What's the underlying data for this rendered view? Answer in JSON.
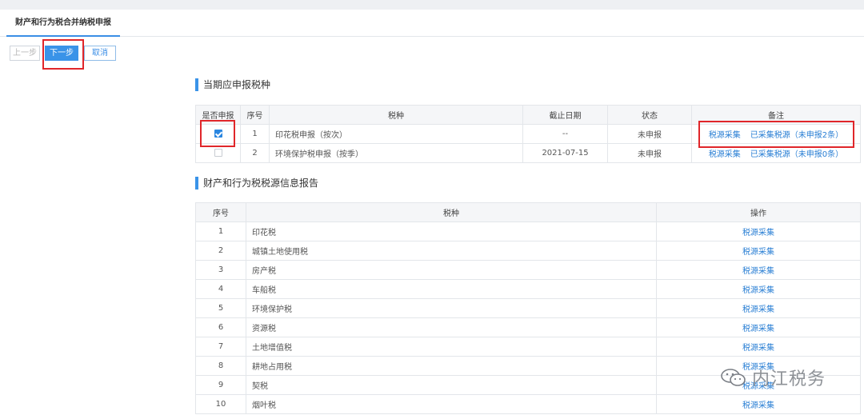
{
  "tab": {
    "label": "财产和行为税合并纳税申报"
  },
  "buttons": {
    "prev": "上一步",
    "next": "下一步",
    "cancel": "取消"
  },
  "section1": {
    "title": "当期应申报税种",
    "columns": [
      "是否申报",
      "序号",
      "税种",
      "截止日期",
      "状态",
      "备注"
    ],
    "rows": [
      {
        "checked": true,
        "no": "1",
        "tax": "印花税申报（按次）",
        "deadline": "--",
        "status": "未申报",
        "link1": "税源采集",
        "link2": "已采集税源（未申报2条）"
      },
      {
        "checked": false,
        "no": "2",
        "tax": "环境保护税申报（按季）",
        "deadline": "2021-07-15",
        "status": "未申报",
        "link1": "税源采集",
        "link2": "已采集税源（未申报0条）"
      }
    ]
  },
  "section2": {
    "title": "财产和行为税税源信息报告",
    "columns": [
      "序号",
      "税种",
      "操作"
    ],
    "rows": [
      {
        "no": "1",
        "tax": "印花税",
        "action": "税源采集"
      },
      {
        "no": "2",
        "tax": "城镇土地使用税",
        "action": "税源采集"
      },
      {
        "no": "3",
        "tax": "房产税",
        "action": "税源采集"
      },
      {
        "no": "4",
        "tax": "车船税",
        "action": "税源采集"
      },
      {
        "no": "5",
        "tax": "环境保护税",
        "action": "税源采集"
      },
      {
        "no": "6",
        "tax": "资源税",
        "action": "税源采集"
      },
      {
        "no": "7",
        "tax": "土地增值税",
        "action": "税源采集"
      },
      {
        "no": "8",
        "tax": "耕地占用税",
        "action": "税源采集"
      },
      {
        "no": "9",
        "tax": "契税",
        "action": "税源采集"
      },
      {
        "no": "10",
        "tax": "烟叶税",
        "action": "税源采集"
      }
    ]
  },
  "watermark": {
    "text": "内江税务",
    "icon": "wechat-icon"
  },
  "colors": {
    "accent": "#3a93e8",
    "link": "#2a7fd4",
    "highlight": "#e0262a"
  }
}
